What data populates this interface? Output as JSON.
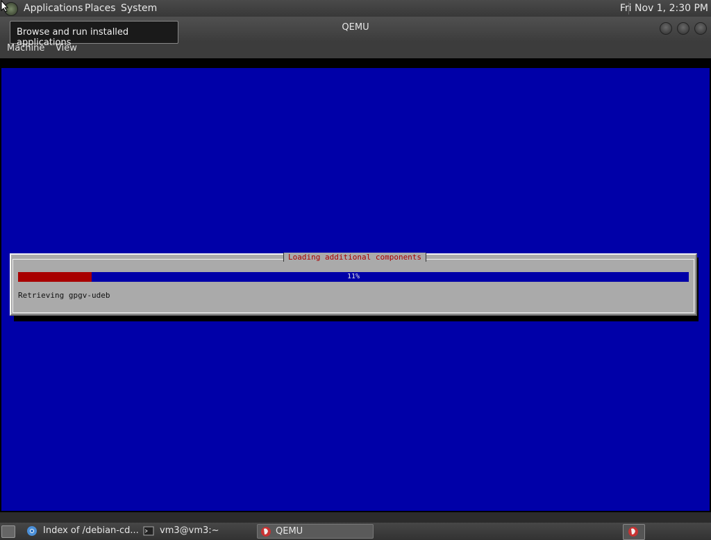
{
  "top_panel": {
    "menus": [
      "Applications",
      "Places",
      "System"
    ],
    "clock": "Fri Nov 1,  2:30 PM",
    "logo_icon": "gnome-foot-icon"
  },
  "tooltip": {
    "text": "Browse and run installed applications"
  },
  "qemu_window": {
    "title": "QEMU",
    "menus": [
      "Machine",
      "View"
    ]
  },
  "installer": {
    "dialog_title": "Loading additional components",
    "progress_percent": 11,
    "progress_label": "11%",
    "status": "Retrieving gpgv-udeb",
    "colors": {
      "background": "#0000a8",
      "dialog": "#aaaaaa",
      "accent": "#a80000"
    }
  },
  "taskbar": {
    "tasks": [
      {
        "label": "Index of /debian-cd...",
        "icon": "chromium-icon"
      },
      {
        "label": "vm3@vm3:~",
        "icon": "terminal-icon"
      },
      {
        "label": "QEMU",
        "icon": "qemu-icon"
      }
    ]
  }
}
